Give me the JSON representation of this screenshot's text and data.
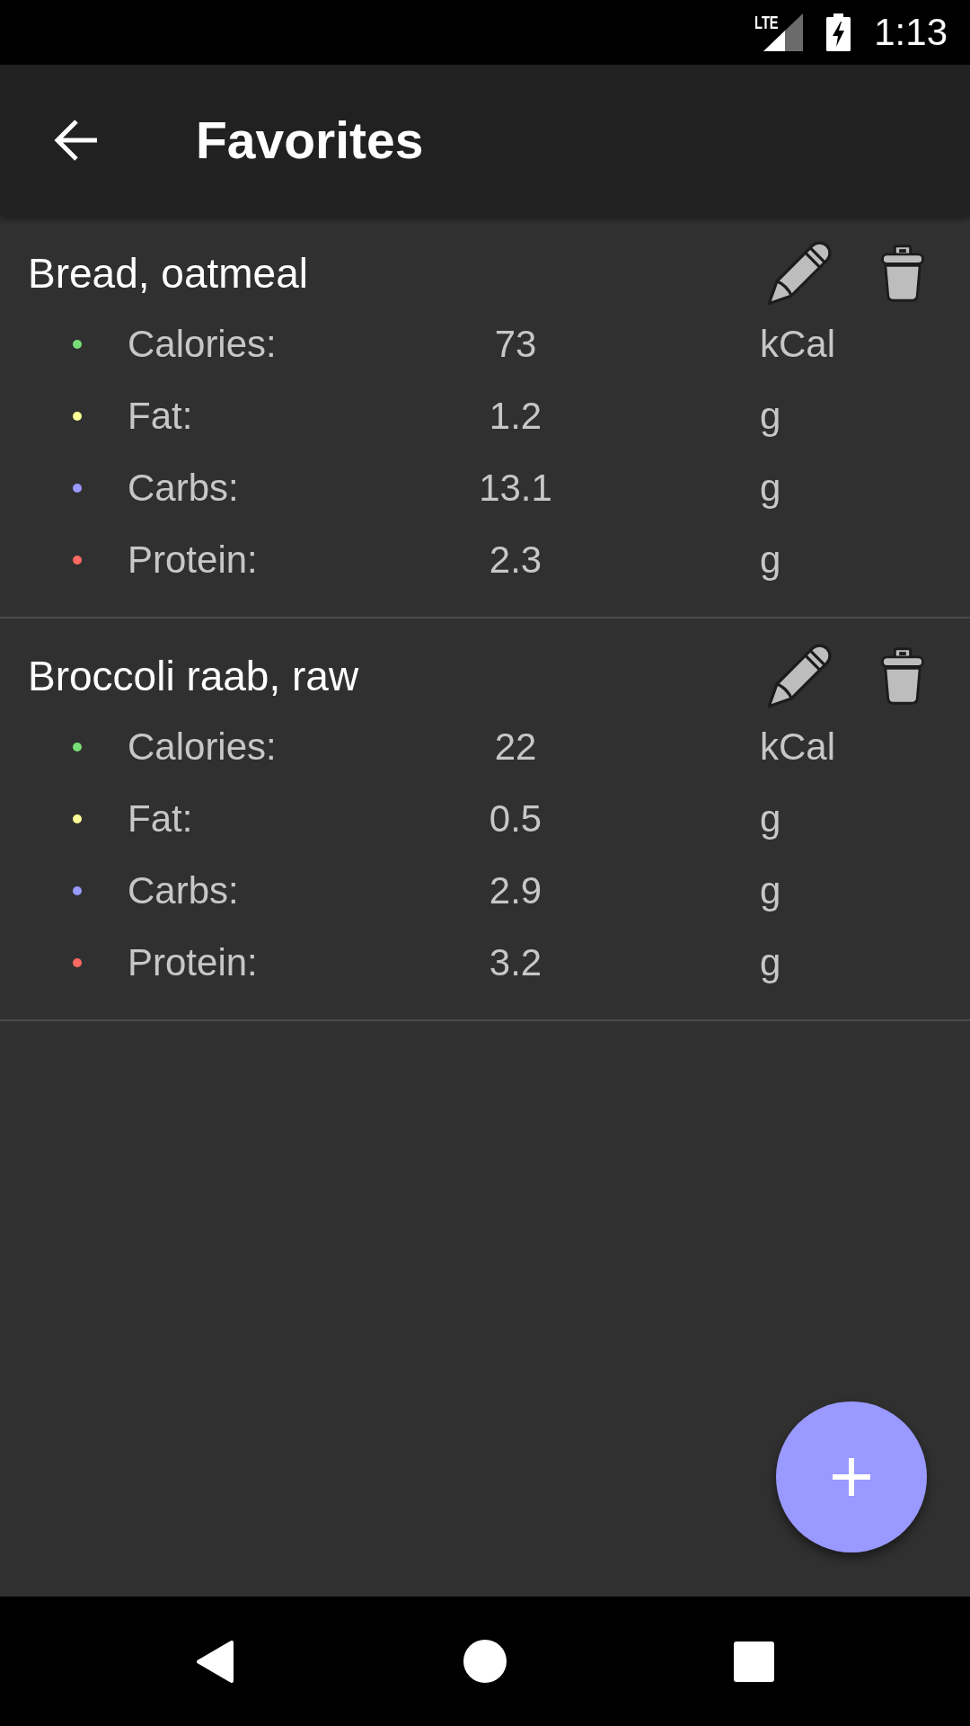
{
  "status_bar": {
    "network": "LTE",
    "time": "1:13"
  },
  "app_bar": {
    "title": "Favorites"
  },
  "foods": [
    {
      "name": "Bread, oatmeal",
      "nutrients": [
        {
          "label": "Calories:",
          "value": "73",
          "unit": "kCal",
          "color": "#77dd77"
        },
        {
          "label": "Fat:",
          "value": "1.2",
          "unit": "g",
          "color": "#fdfd96"
        },
        {
          "label": "Carbs:",
          "value": "13.1",
          "unit": "g",
          "color": "#9999ff"
        },
        {
          "label": "Protein:",
          "value": "2.3",
          "unit": "g",
          "color": "#ff6961"
        }
      ]
    },
    {
      "name": "Broccoli raab, raw",
      "nutrients": [
        {
          "label": "Calories:",
          "value": "22",
          "unit": "kCal",
          "color": "#77dd77"
        },
        {
          "label": "Fat:",
          "value": "0.5",
          "unit": "g",
          "color": "#fdfd96"
        },
        {
          "label": "Carbs:",
          "value": "2.9",
          "unit": "g",
          "color": "#9999ff"
        },
        {
          "label": "Protein:",
          "value": "3.2",
          "unit": "g",
          "color": "#ff6961"
        }
      ]
    }
  ]
}
